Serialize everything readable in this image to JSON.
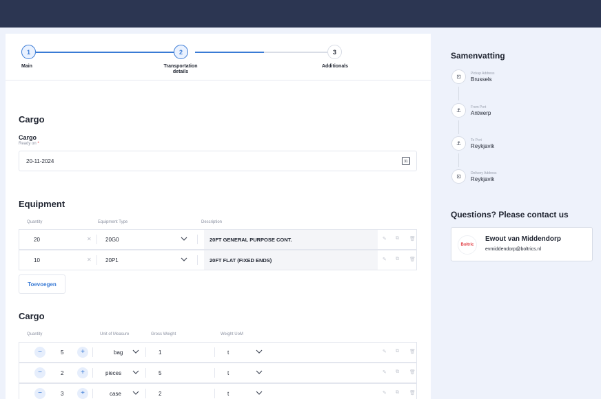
{
  "stepper": {
    "steps": [
      {
        "num": "1",
        "label": "Main"
      },
      {
        "num": "2",
        "label": "Transportation details"
      },
      {
        "num": "3",
        "label": "Additionals"
      }
    ]
  },
  "cargo_date": {
    "section_title": "Cargo",
    "field_label": "Cargo",
    "sub_label": "Ready on",
    "required_mark": "*",
    "value": "20-11-2024",
    "icon": "calendar-icon",
    "calendar_num": "31"
  },
  "equipment": {
    "title": "Equipment",
    "headers": [
      "Quantity",
      "Equipment Type",
      "Description"
    ],
    "rows": [
      {
        "quantity": "20",
        "type": "20G0",
        "description": "20FT GENERAL PURPOSE CONT."
      },
      {
        "quantity": "10",
        "type": "20P1",
        "description": "20FT FLAT (FIXED ENDS)"
      }
    ],
    "add_label": "Toevoegen"
  },
  "cargo": {
    "title": "Cargo",
    "headers": [
      "Quantity",
      "Unit of Measure",
      "Gross Weight",
      "Weight UoM"
    ],
    "rows": [
      {
        "quantity": "5",
        "unit": "bag",
        "gross_weight": "1",
        "weight_uom": "t"
      },
      {
        "quantity": "2",
        "unit": "pieces",
        "gross_weight": "5",
        "weight_uom": "t"
      },
      {
        "quantity": "3",
        "unit": "case",
        "gross_weight": "2",
        "weight_uom": "t"
      }
    ]
  },
  "summary": {
    "title": "Samenvatting",
    "items": [
      {
        "small": "Pickup Address",
        "value": "Brussels",
        "icon": "address-icon"
      },
      {
        "small": "From Port",
        "value": "Antwerp",
        "icon": "anchor-icon"
      },
      {
        "small": "To Port",
        "value": "Reykjavik",
        "icon": "anchor-icon"
      },
      {
        "small": "Delivery Address",
        "value": "Reykjavik",
        "icon": "address-icon"
      }
    ]
  },
  "contact": {
    "title": "Questions? Please contact us",
    "logo_text": "Boltric",
    "name": "Ewout van Middendorp",
    "email": "evmiddendorp@boltrics.nl"
  },
  "colors": {
    "topbar": "#2c3652",
    "accent": "#3a7bd5",
    "required": "#e0383e"
  }
}
